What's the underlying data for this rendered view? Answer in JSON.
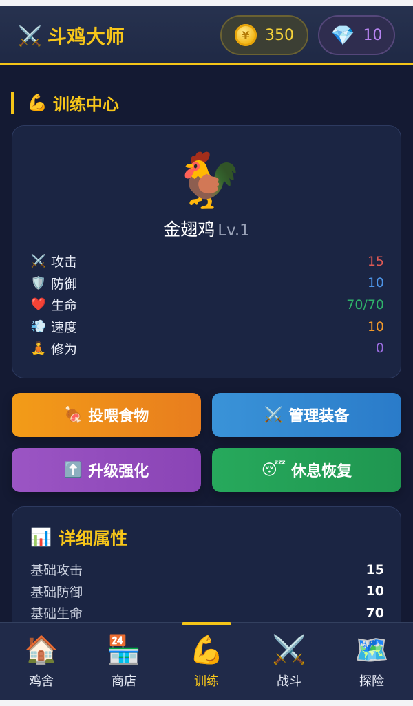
{
  "header": {
    "title": "斗鸡大师",
    "title_icon": "⚔️",
    "coins": "350",
    "coin_icon": "🪙",
    "gems": "10",
    "gem_icon": "💎"
  },
  "section": {
    "title": "训练中心",
    "icon": "💪"
  },
  "chicken": {
    "image": "🐓",
    "name": "金翅鸡",
    "level": "Lv.1",
    "stats": [
      {
        "icon": "⚔️",
        "label": "攻击",
        "value": "15",
        "color": "#e05a55"
      },
      {
        "icon": "🛡️",
        "label": "防御",
        "value": "10",
        "color": "#4d94e6"
      },
      {
        "icon": "❤️",
        "label": "生命",
        "value": "70/70",
        "color": "#2fb36a"
      },
      {
        "icon": "💨",
        "label": "速度",
        "value": "10",
        "color": "#f29a2b"
      },
      {
        "icon": "🧘",
        "label": "修为",
        "value": "0",
        "color": "#9b6ce0"
      }
    ]
  },
  "actions": {
    "feed": {
      "icon": "🍖",
      "label": "投喂食物",
      "color": "#f39c18"
    },
    "equip": {
      "icon": "⚔️",
      "label": "管理装备",
      "color": "#3a93d8"
    },
    "upgrade": {
      "icon": "⬆️",
      "label": "升级强化",
      "color": "#9b55c4"
    },
    "rest": {
      "icon": "😴",
      "label": "休息恢复",
      "color": "#27a95c"
    }
  },
  "details": {
    "title": "详细属性",
    "icon": "📊",
    "rows": [
      {
        "label": "基础攻击",
        "value": "15"
      },
      {
        "label": "基础防御",
        "value": "10"
      },
      {
        "label": "基础生命",
        "value": "70"
      }
    ]
  },
  "nav": {
    "items": [
      {
        "icon": "🏠",
        "label": "鸡舍"
      },
      {
        "icon": "🏪",
        "label": "商店"
      },
      {
        "icon": "💪",
        "label": "训练"
      },
      {
        "icon": "⚔️",
        "label": "战斗"
      },
      {
        "icon": "🗺️",
        "label": "探险"
      }
    ],
    "active_index": 2
  },
  "colors": {
    "accent": "#f5c518",
    "background": "#141a33",
    "card": "#1b2543"
  }
}
